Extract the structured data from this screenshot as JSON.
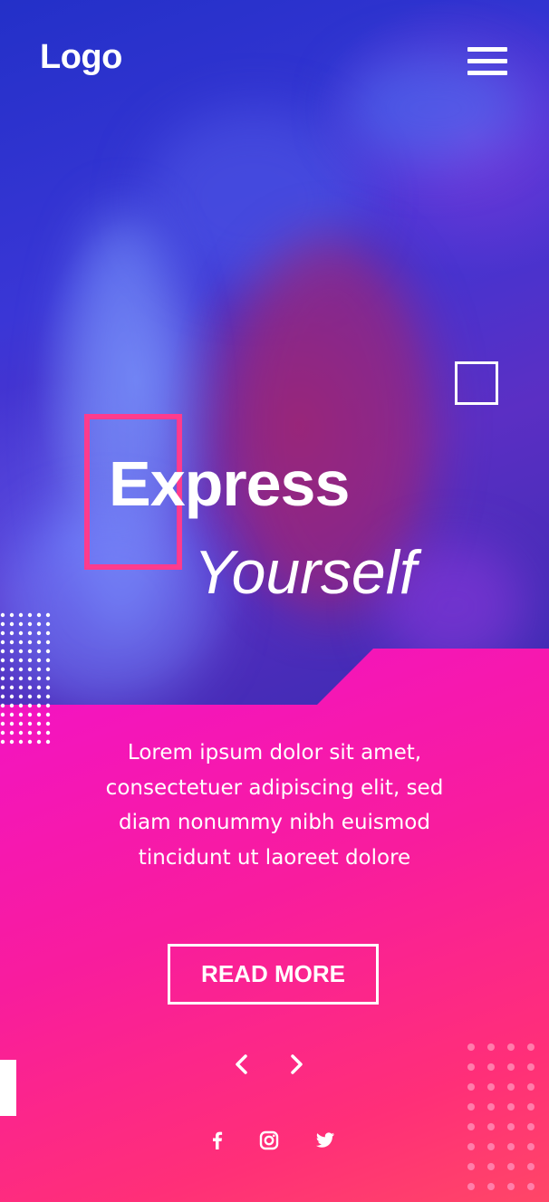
{
  "header": {
    "logo_text": "Logo",
    "menu_icon": "hamburger-menu-icon"
  },
  "hero": {
    "title_line1": "Express",
    "title_line2": "Yourself"
  },
  "content": {
    "description": "Lorem ipsum dolor sit amet, consectetuer adipiscing elit, sed diam nonummy nibh euismod tincidunt ut laoreet dolore",
    "read_more_label": "READ MORE"
  },
  "slider": {
    "prev_icon": "chevron-left-icon",
    "next_icon": "chevron-right-icon"
  },
  "social": [
    {
      "icon": "facebook-icon"
    },
    {
      "icon": "instagram-icon"
    },
    {
      "icon": "twitter-icon"
    }
  ],
  "colors": {
    "accent_magenta": "#f212c9",
    "accent_pink": "#ff3b8d",
    "hero_blue": "#2f33cf",
    "text": "#ffffff"
  }
}
